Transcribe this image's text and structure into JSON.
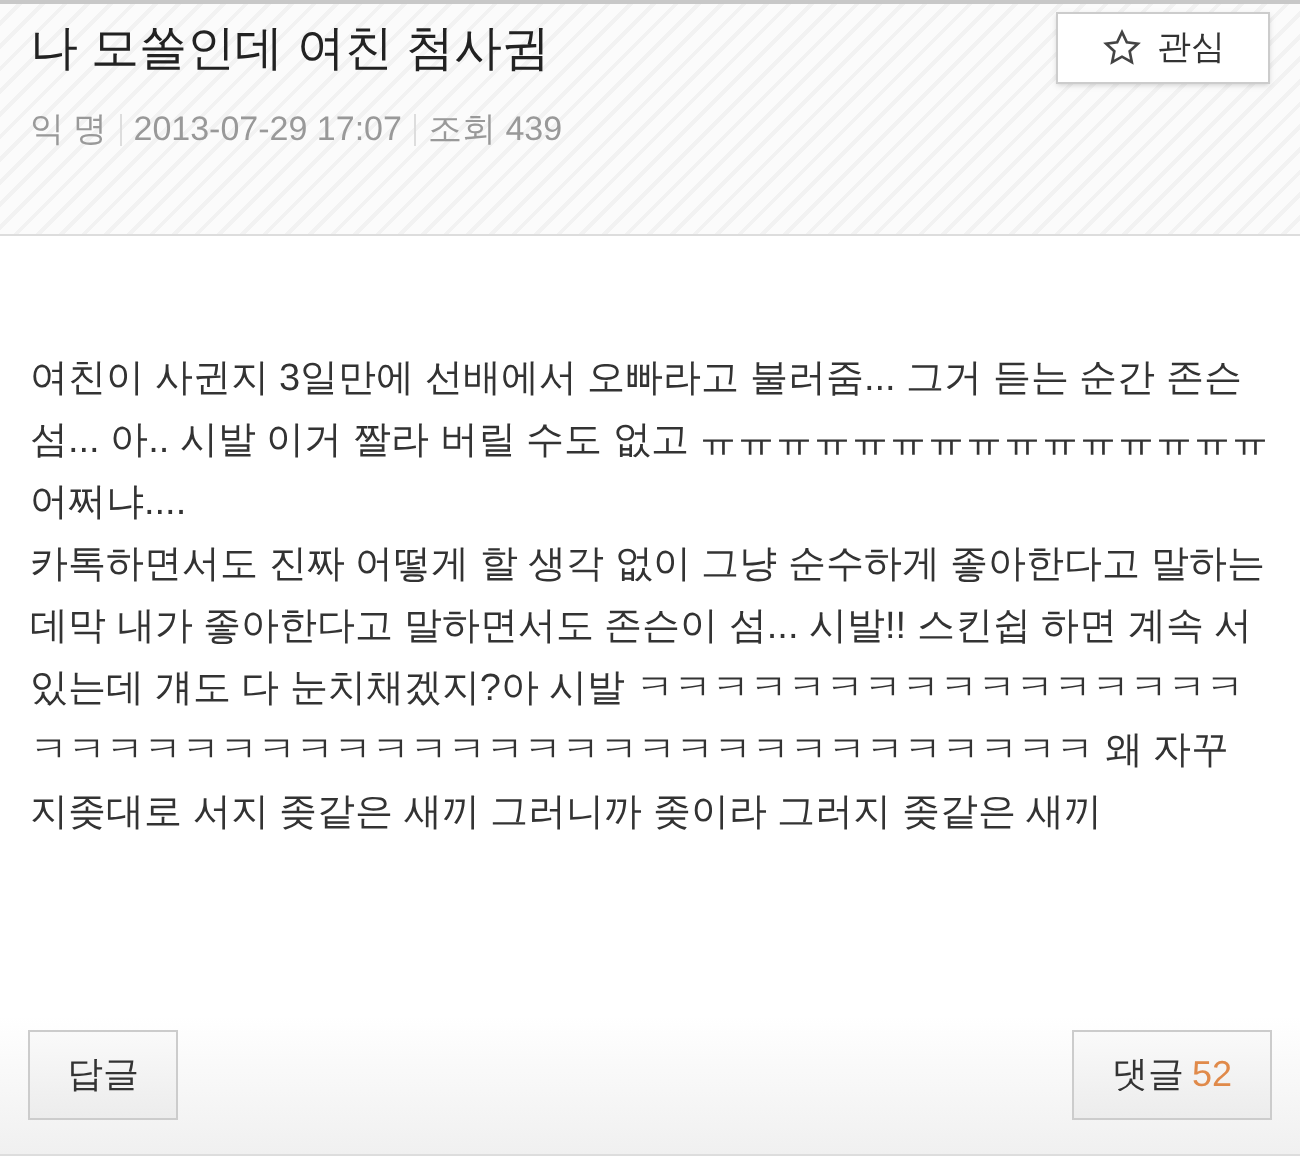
{
  "post": {
    "title": "나 모쏠인데 여친 첨사귐",
    "author": "익 명",
    "date": "2013-07-29 17:07",
    "views_label": "조회",
    "views": "439"
  },
  "follow_button": {
    "label": "관심"
  },
  "body": [
    "여친이 사귄지 3일만에 선배에서 오빠라고 불러줌... 그거 듣는 순간 존슨 섬... 아.. 시발 이거 짤라 버릴 수도 없고 ㅠㅠㅠㅠㅠㅠㅠㅠㅠㅠㅠㅠㅠㅠㅠ 어쩌냐....",
    "카톡하면서도 진짜 어떻게 할 생각 없이 그냥 순수하게 좋아한다고 말하는데막 내가 좋아한다고 말하면서도 존슨이 섬... 시발!! 스킨쉽 하면 계속 서 있는데 걔도 다 눈치채겠지?아 시발 ㅋㅋㅋㅋㅋㅋㅋㅋㅋㅋㅋㅋㅋㅋㅋㅋㅋㅋㅋㅋㅋㅋㅋㅋㅋㅋㅋㅋㅋㅋㅋㅋㅋㅋㅋㅋㅋㅋㅋㅋㅋㅋㅋㅋ 왜 자꾸 지좆대로 서지 좆같은 새끼 그러니까 좆이라 그러지 좆같은 새끼"
  ],
  "footer": {
    "reply_button": "답글",
    "comments_button": {
      "label": "댓글",
      "count": "52"
    }
  }
}
